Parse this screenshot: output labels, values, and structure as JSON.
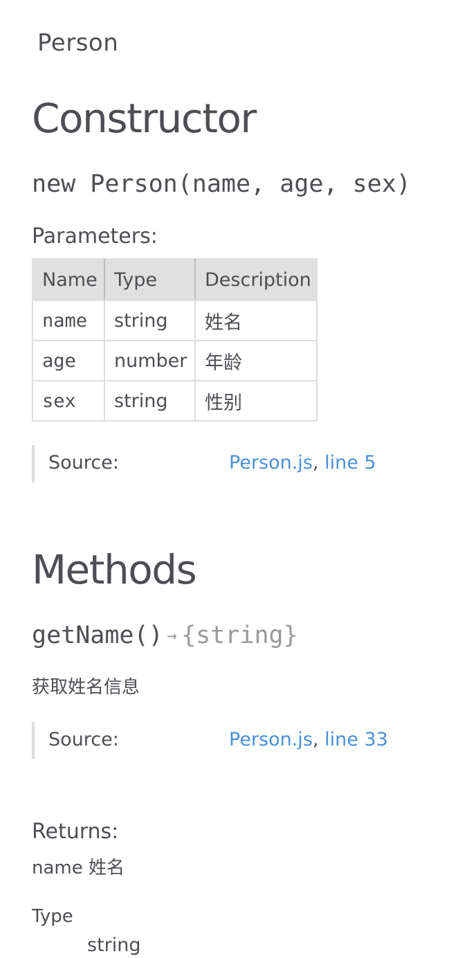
{
  "class": {
    "name": "Person"
  },
  "constructor": {
    "heading": "Constructor",
    "signature": "new Person(name, age, sex)",
    "parameters_heading": "Parameters:",
    "table": {
      "headers": [
        "Name",
        "Type",
        "Description"
      ],
      "rows": [
        {
          "name": "name",
          "type": "string",
          "description": "姓名"
        },
        {
          "name": "age",
          "type": "number",
          "description": "年龄"
        },
        {
          "name": "sex",
          "type": "string",
          "description": "性别"
        }
      ]
    },
    "source": {
      "label": "Source:",
      "file": "Person.js",
      "separator": ",",
      "line": "line 5"
    }
  },
  "methods": {
    "heading": "Methods",
    "items": [
      {
        "signature": "getName()",
        "arrow": "→",
        "return_type": "{string}",
        "description": "获取姓名信息",
        "source": {
          "label": "Source:",
          "file": "Person.js",
          "separator": ",",
          "line": "line 33"
        },
        "returns_heading": "Returns:",
        "returns_description": "name 姓名",
        "type_label": "Type",
        "type_value": "string"
      }
    ]
  },
  "colors": {
    "text": "#4d4e53",
    "link": "#4a90d9",
    "header_bg": "#e0e0e0",
    "border": "#dddddd"
  }
}
